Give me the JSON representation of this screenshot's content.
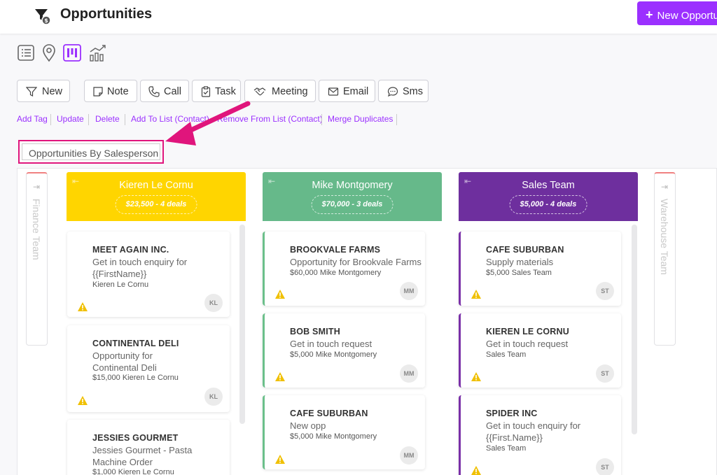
{
  "header": {
    "title": "Opportunities",
    "new_button_label": "New Opportunity"
  },
  "view_icons": [
    "list-view-icon",
    "map-pin-icon",
    "board-view-icon",
    "chart-view-icon"
  ],
  "toolbar": {
    "new": "New",
    "note": "Note",
    "call": "Call",
    "task": "Task",
    "meeting": "Meeting",
    "email": "Email",
    "sms": "Sms"
  },
  "bulk_actions": {
    "add_tag": "Add Tag",
    "update": "Update",
    "delete": "Delete",
    "add_to_list": "Add To List (Contact)",
    "remove_from_list": "Remove From List (Contact)",
    "merge_duplicates": "Merge Duplicates"
  },
  "pipeline": {
    "selected": "Opportunities By Salesperson"
  },
  "colors": {
    "accent": "#9b30ff",
    "highlight": "#e0157c",
    "kieren": "#ffd500",
    "mike": "#66b98a",
    "sales": "#6e2f9e"
  },
  "collapsed_columns": {
    "left": "Finance Team",
    "right": "Warehouse Team"
  },
  "columns": [
    {
      "name": "Kieren Le Cornu",
      "summary": "$23,500 - 4 deals",
      "cards": [
        {
          "title": "MEET AGAIN INC.",
          "desc": "Get in touch enquiry for {{FirstName}}",
          "meta": "Kieren Le Cornu",
          "avatar": "KL"
        },
        {
          "title": "CONTINENTAL DELI",
          "desc": "Opportunity for Continental Deli",
          "meta": "$15,000   Kieren Le Cornu",
          "avatar": "KL"
        },
        {
          "title": "JESSIES GOURMET",
          "desc": "Jessies Gourmet - Pasta Machine Order",
          "meta": "$1,000   Kieren Le Cornu",
          "avatar": ""
        }
      ]
    },
    {
      "name": "Mike Montgomery",
      "summary": "$70,000 - 3 deals",
      "cards": [
        {
          "title": "BROOKVALE FARMS",
          "desc": "Opportunity for Brookvale Farms",
          "meta": "$60,000   Mike Montgomery",
          "avatar": "MM"
        },
        {
          "title": "BOB SMITH",
          "desc": "Get in touch request",
          "meta": "$5,000   Mike Montgomery",
          "avatar": "MM"
        },
        {
          "title": "CAFE SUBURBAN",
          "desc": "New opp",
          "meta": "$5,000   Mike Montgomery",
          "avatar": "MM"
        }
      ]
    },
    {
      "name": "Sales Team",
      "summary": "$5,000 - 4 deals",
      "cards": [
        {
          "title": "CAFE SUBURBAN",
          "desc": "Supply materials",
          "meta": "$5,000   Sales Team",
          "avatar": "ST"
        },
        {
          "title": "KIEREN LE CORNU",
          "desc": "Get in touch request",
          "meta": "Sales Team",
          "avatar": "ST"
        },
        {
          "title": "SPIDER INC",
          "desc": "Get in touch enquiry for {{First.Name}}",
          "meta": "Sales Team",
          "avatar": "ST"
        }
      ]
    }
  ]
}
